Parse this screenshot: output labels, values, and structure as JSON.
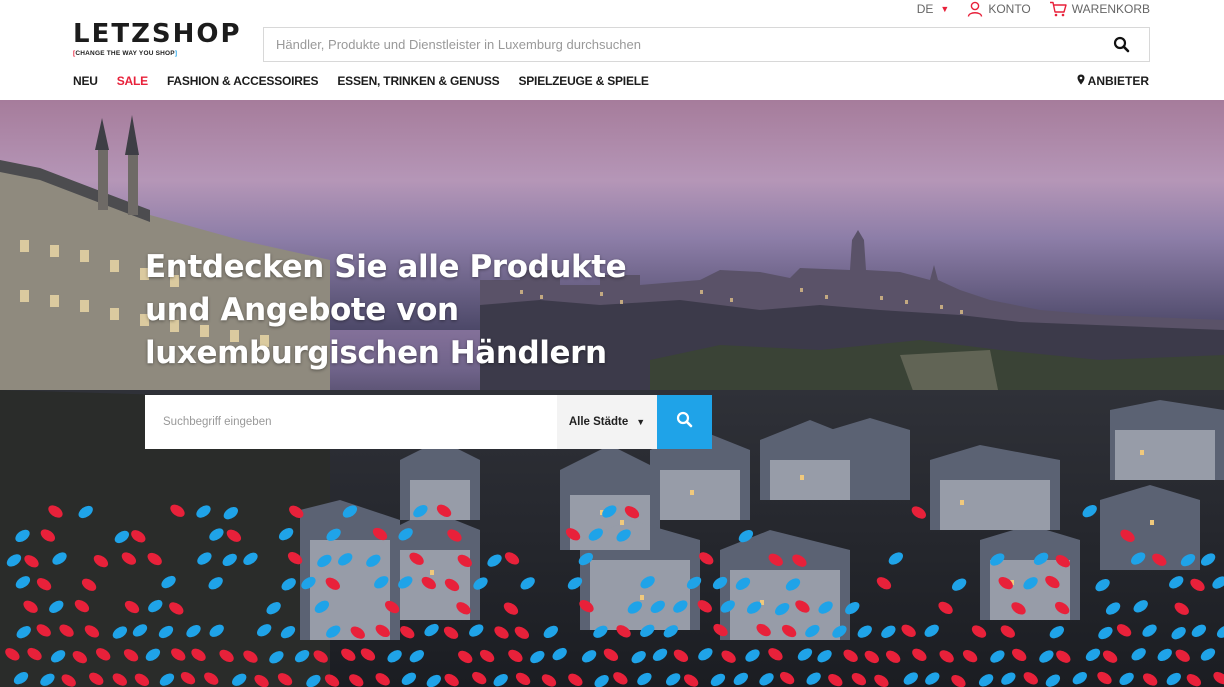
{
  "header": {
    "logo_text": "LETZSHOP",
    "logo_tagline": "CHANGE THE WAY YOU SHOP",
    "lang": "DE",
    "account_label": "KONTO",
    "cart_label": "WARENKORB",
    "search_placeholder": "Händler, Produkte und Dienstleister in Luxemburg durchsuchen"
  },
  "nav": {
    "items": [
      {
        "label": "NEU"
      },
      {
        "label": "SALE"
      },
      {
        "label": "FASHION & ACCESSOIRES"
      },
      {
        "label": "ESSEN, TRINKEN & GENUSS"
      },
      {
        "label": "SPIELZEUGE & SPIELE"
      }
    ],
    "anbieter_label": "ANBIETER"
  },
  "hero": {
    "title_line1": "Entdecken Sie alle Produkte",
    "title_line2": "und Angebote von",
    "title_line3": "luxemburgischen Händlern",
    "search_placeholder": "Suchbegriff eingeben",
    "city_select": "Alle Städte"
  },
  "colors": {
    "accent_red": "#e8213a",
    "accent_blue": "#1fa3e8",
    "text_dark": "#1c1c1c"
  },
  "icons": [
    "search-icon",
    "user-icon",
    "cart-icon",
    "map-pin-icon",
    "chevron-down-icon"
  ]
}
